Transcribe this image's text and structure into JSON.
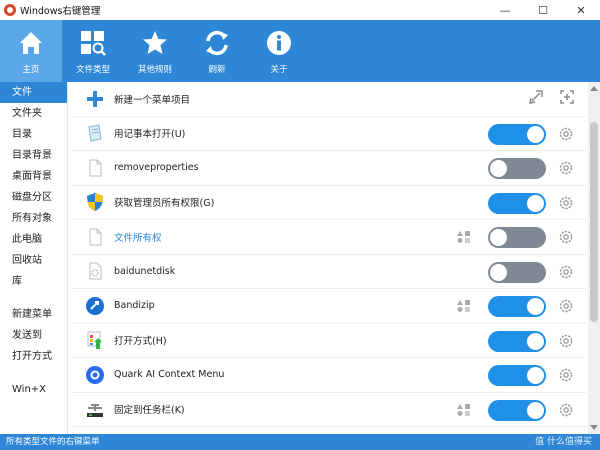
{
  "window": {
    "title": "Windows右键管理",
    "minimize": "—",
    "maximize": "☐",
    "close": "✕"
  },
  "toolbar": [
    {
      "label": "主页",
      "icon": "home-icon",
      "active": true
    },
    {
      "label": "文件类型",
      "icon": "file-types-icon"
    },
    {
      "label": "其他规则",
      "icon": "star-icon"
    },
    {
      "label": "刷新",
      "icon": "refresh-icon"
    },
    {
      "label": "关于",
      "icon": "info-icon"
    }
  ],
  "sidebar": {
    "items": [
      "文件",
      "文件夹",
      "目录",
      "目录背景",
      "桌面背景",
      "磁盘分区",
      "所有对象",
      "此电脑",
      "回收站",
      "库"
    ],
    "group2": [
      "新建菜单",
      "发送到",
      "打开方式"
    ],
    "group3": [
      "Win+X"
    ],
    "active_index": 0
  },
  "content": {
    "new_item_label": "新建一个菜单项目",
    "rows": [
      {
        "label": "用记事本打开(U)",
        "icon": "notepad-icon",
        "on": true
      },
      {
        "label": "removeproperties",
        "icon": "blank-file-icon",
        "on": false
      },
      {
        "label": "获取管理员所有权限(G)",
        "icon": "uac-shield-icon",
        "on": true
      },
      {
        "label": "文件所有权",
        "icon": "blank-file-icon",
        "on": false,
        "link": true,
        "shapes": true
      },
      {
        "label": "baidunetdisk",
        "icon": "gear-file-icon",
        "on": false
      },
      {
        "label": "Bandizip",
        "icon": "bandizip-icon",
        "on": true,
        "shapes": true
      },
      {
        "label": "打开方式(H)",
        "icon": "open-with-icon",
        "on": true
      },
      {
        "label": "Quark AI Context Menu",
        "icon": "quark-icon",
        "on": true
      },
      {
        "label": "固定到任务栏(K)",
        "icon": "pin-taskbar-icon",
        "on": true,
        "shapes": true
      }
    ]
  },
  "statusbar": {
    "text": "所有类型文件的右键菜单",
    "watermark": "值 什么值得买"
  },
  "colors": {
    "accent": "#2e86d6",
    "toggle_on": "#1e90e8",
    "toggle_off": "#808a95"
  }
}
